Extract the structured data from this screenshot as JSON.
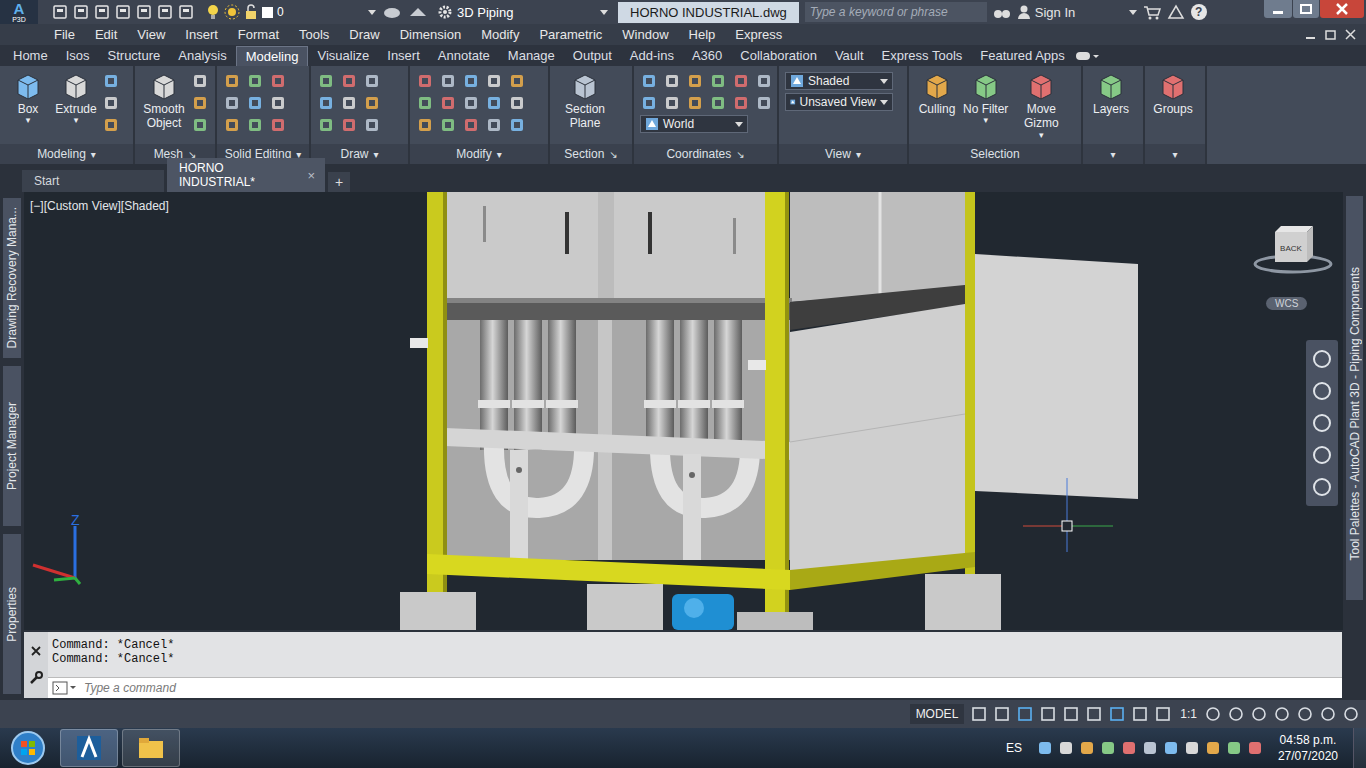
{
  "title_bar": {
    "logo": "A",
    "logo_badge": "P3D",
    "layer": "0",
    "workspace": "3D Piping",
    "title": "HORNO INDUSTRIAL.dwg",
    "search_placeholder": "Type a keyword or phrase",
    "sign_in": "Sign In",
    "help": "?"
  },
  "menu": [
    "File",
    "Edit",
    "View",
    "Insert",
    "Format",
    "Tools",
    "Draw",
    "Dimension",
    "Modify",
    "Parametric",
    "Window",
    "Help",
    "Express"
  ],
  "ribbon_tabs": [
    {
      "label": "Home",
      "selected": false
    },
    {
      "label": "Isos",
      "selected": false
    },
    {
      "label": "Structure",
      "selected": false
    },
    {
      "label": "Analysis",
      "selected": false
    },
    {
      "label": "Modeling",
      "selected": true
    },
    {
      "label": "Visualize",
      "selected": false
    },
    {
      "label": "Insert",
      "selected": false
    },
    {
      "label": "Annotate",
      "selected": false
    },
    {
      "label": "Manage",
      "selected": false
    },
    {
      "label": "Output",
      "selected": false
    },
    {
      "label": "Add-ins",
      "selected": false
    },
    {
      "label": "A360",
      "selected": false
    },
    {
      "label": "Collaboration",
      "selected": false
    },
    {
      "label": "Vault",
      "selected": false
    },
    {
      "label": "Express Tools",
      "selected": false
    },
    {
      "label": "Featured Apps",
      "selected": false
    }
  ],
  "ribbon_panels": [
    {
      "title": "Modeling",
      "marker": "▾",
      "tools": [
        {
          "kind": "large",
          "label": "Box",
          "marker": "▾"
        },
        {
          "kind": "large",
          "label": "Extrude",
          "marker": "▾"
        }
      ]
    },
    {
      "title": "Mesh",
      "marker": "↘",
      "tools": [
        {
          "kind": "large",
          "label": "Smooth Object"
        }
      ]
    },
    {
      "title": "Solid Editing",
      "marker": "▾",
      "tools": []
    },
    {
      "title": "Draw",
      "marker": "▾",
      "tools": []
    },
    {
      "title": "Modify",
      "marker": "▾",
      "tools": []
    },
    {
      "title": "Section",
      "marker": "↘",
      "tools": [
        {
          "kind": "large",
          "label": "Section Plane"
        }
      ]
    },
    {
      "title": "Coordinates",
      "marker": "↘",
      "tools": [
        {
          "kind": "dropdown",
          "label": "World"
        }
      ]
    },
    {
      "title": "View",
      "marker": "▾",
      "tools": [
        {
          "kind": "dropdown",
          "label": "Shaded"
        },
        {
          "kind": "dropdown",
          "label": "Unsaved View"
        }
      ]
    },
    {
      "title": "Selection",
      "tools": [
        {
          "kind": "large",
          "label": "Culling"
        },
        {
          "kind": "large",
          "label": "No Filter",
          "marker": "▾"
        },
        {
          "kind": "large",
          "label": "Move Gizmo",
          "marker": "▾"
        }
      ]
    },
    {
      "marker": "▾",
      "tools": [
        {
          "kind": "large",
          "label": "Layers"
        }
      ]
    },
    {
      "marker": "▾",
      "tools": [
        {
          "kind": "large",
          "label": "Groups"
        }
      ]
    }
  ],
  "doc_tabs": [
    {
      "label": "Start",
      "selected": false
    },
    {
      "label": "HORNO INDUSTRIAL*",
      "selected": true,
      "close": "×"
    }
  ],
  "new_tab": "+",
  "left_palettes": [
    "Drawing Recovery Mana...",
    "Project Manager",
    "Properties"
  ],
  "right_palette": "Tool Palettes - AutoCAD Plant 3D - Piping Components",
  "viewport": {
    "label": "[−][Custom View][Shaded]",
    "viewcube": "BACK",
    "wcs": "WCS",
    "axis_z": "Z"
  },
  "command_history": [
    "Command: *Cancel*",
    "Command: *Cancel*"
  ],
  "command_placeholder": "Type a command",
  "status_bar": {
    "model": "MODEL",
    "scale": "1:1"
  },
  "taskbar": {
    "language": "ES",
    "time": "04:58 p.m.",
    "date": "27/07/2020"
  }
}
